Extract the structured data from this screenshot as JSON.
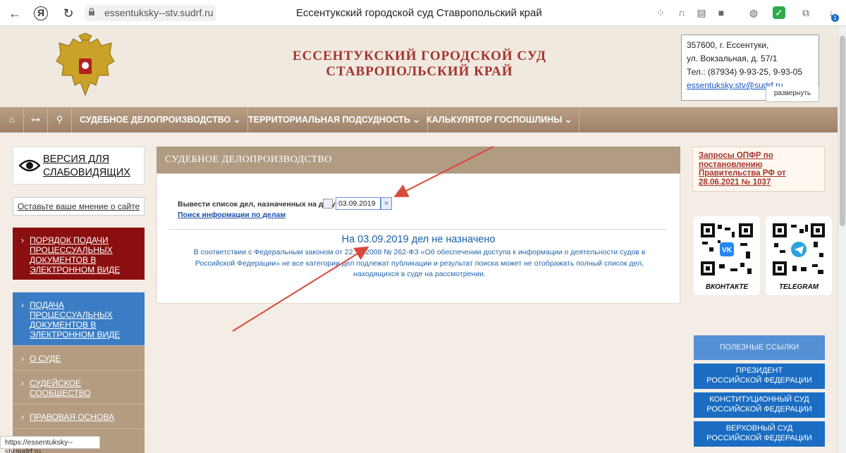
{
  "browser": {
    "url": "essentuksky--stv.sudrf.ru",
    "tab_title": "Ессентукский городской суд Ставропольский край",
    "status_url": "https://essentuksky--stv.sudrf.ru",
    "downloads_badge": "1"
  },
  "header": {
    "title_line1": "ЕССЕНТУКСКИЙ ГОРОДСКОЙ СУД",
    "title_line2": "СТАВРОПОЛЬСКИЙ КРАЙ",
    "address": {
      "line1": "357600, г. Ессентуки,",
      "line2": "ул. Вокзальная, д. 57/1",
      "phone": "Тел.: (87934) 9-93-25, 9-93-05",
      "email": "essentuksky.stv@sudrf.ru",
      "expand_label": "развернуть"
    }
  },
  "nav": {
    "items": [
      {
        "label": "СУДЕБНОЕ ДЕЛОПРОИЗВОДСТВО"
      },
      {
        "label": "ТЕРРИТОРИАЛЬНАЯ ПОДСУДНОСТЬ"
      },
      {
        "label": "КАЛЬКУЛЯТОР ГОСПОШЛИНЫ"
      }
    ],
    "chevron": "⌄"
  },
  "sidebar": {
    "vision_label": "ВЕРСИЯ ДЛЯ СЛАБОВИДЯЩИХ",
    "opinion_label": "Оставьте ваше мнение о сайте",
    "items": [
      {
        "label": "ПОРЯДОК ПОДАЧИ ПРОЦЕССУАЛЬНЫХ ДОКУМЕНТОВ В ЭЛЕКТРОННОМ ВИДЕ"
      },
      {
        "label": "ПОДАЧА ПРОЦЕССУАЛЬНЫХ ДОКУМЕНТОВ В ЭЛЕКТРОННОМ ВИДЕ"
      },
      {
        "label": "О СУДЕ"
      },
      {
        "label": "СУДЕЙСКОЕ СООБЩЕСТВО"
      },
      {
        "label": "ПРАВОВАЯ ОСНОВА"
      }
    ],
    "chevron": "›"
  },
  "main": {
    "section_title": "СУДЕБНОЕ ДЕЛОПРОИЗВОДСТВО",
    "date_label": "Вывести список дел, назначенных на дату",
    "date_value": "03.09.2019",
    "go_symbol": "»",
    "search_link": "Поиск информации по делам",
    "result_text": "На 03.09.2019 дел не назначено",
    "law_note": "В соответствии с Федеральным законом от 22.12.2008 № 262-ФЗ «Об обеспечении доступа к информации о деятельности судов в Российской Федерации» не все категории дел подлежат публикации и результат поиска может не отображать полный список дел, находящихся в суде на рассмотрении."
  },
  "right": {
    "pfr_link": "Запросы ОПФР по постановлению Правительства РФ от 28.06.2021 № 1037",
    "qr_vk_caption": "ВКОНТАКТЕ",
    "qr_tg_caption": "TELEGRAM",
    "useful_links": "ПОЛЕЗНЫЕ ССЫЛКИ",
    "links": [
      {
        "line1": "ПРЕЗИДЕНТ",
        "line2": "РОССИЙСКОЙ ФЕДЕРАЦИИ"
      },
      {
        "line1": "КОНСТИТУЦИОННЫЙ СУД",
        "line2": "РОССИЙСКОЙ ФЕДЕРАЦИИ"
      },
      {
        "line1": "ВЕРХОВНЫЙ СУД",
        "line2": "РОССИЙСКОЙ ФЕДЕРАЦИИ"
      }
    ]
  },
  "colors": {
    "accent_red": "#8b0f0f",
    "accent_blue": "#1a6dc2",
    "nav_tan": "#9d8168",
    "annotation_arrow": "#d9493c"
  }
}
